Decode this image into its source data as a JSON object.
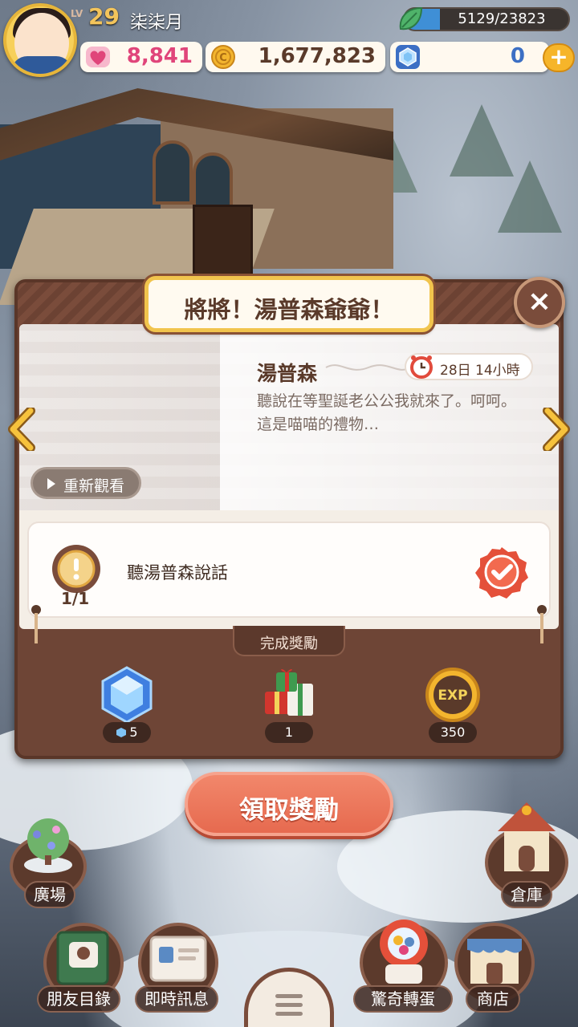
{
  "player": {
    "level_label": "LV",
    "level": "29",
    "name": "柒柒月",
    "xp_text": "5129/23823",
    "xp_fraction": 0.2153
  },
  "resources": {
    "hearts": "8,841",
    "coins": "1,677,823",
    "gems": "0",
    "plus": "+"
  },
  "quest": {
    "title": "將將！湯普森爺爺！",
    "close": "×",
    "speaker": "湯普森",
    "timer": "28日 14小時",
    "dialog_line1": "聽說在等聖誕老公公我就來了。呵呵。",
    "dialog_line2": "這是喵喵的禮物…",
    "replay": "重新觀看",
    "task": {
      "progress": "1/1",
      "text": "聽湯普森說話",
      "done": true
    },
    "rewards_title": "完成獎勵",
    "rewards": [
      {
        "icon": "diamond-icon",
        "count": "5"
      },
      {
        "icon": "gift-box-icon",
        "count": "1"
      },
      {
        "icon": "exp-icon",
        "label": "EXP",
        "count": "350"
      }
    ],
    "claim": "領取獎勵"
  },
  "nav": {
    "plaza": "廣場",
    "storage": "倉庫",
    "friends": "朋友目錄",
    "messages": "即時訊息",
    "gacha": "驚奇轉蛋",
    "shop": "商店"
  },
  "colors": {
    "accent_gold": "#f1c44d",
    "brown": "#6e4536",
    "claim_red": "#e66a4f",
    "heart_pink": "#e0457a"
  }
}
